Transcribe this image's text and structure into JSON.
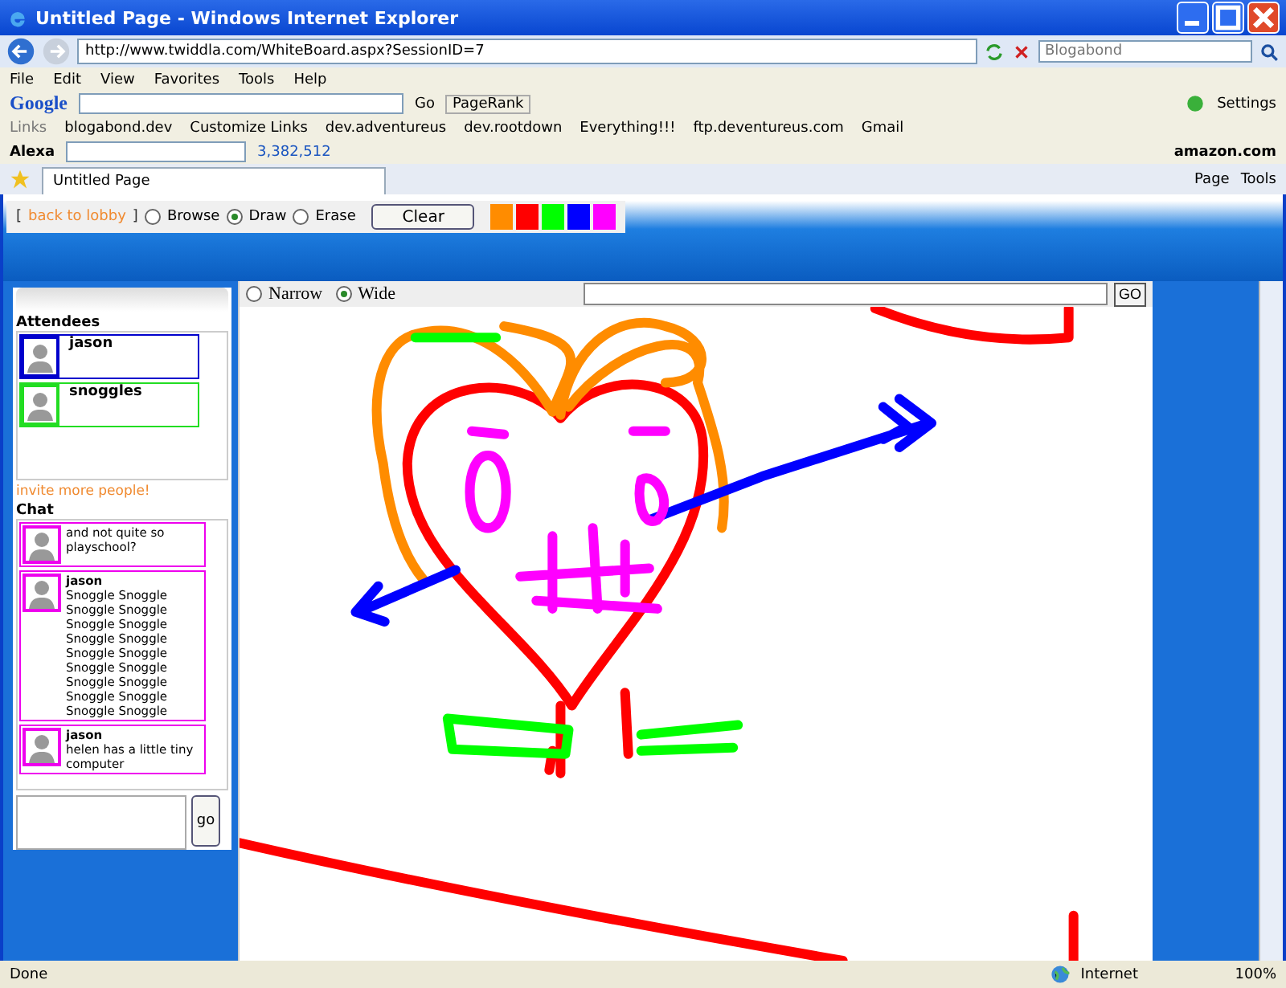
{
  "window": {
    "title": "Untitled Page - Windows Internet Explorer"
  },
  "address_bar": {
    "url": "http://www.twiddla.com/WhiteBoard.aspx?SessionID=7",
    "search_placeholder": "Blogabond"
  },
  "menu": [
    "File",
    "Edit",
    "View",
    "Favorites",
    "Tools",
    "Help"
  ],
  "google_toolbar": {
    "logo": "Google",
    "go": "Go",
    "pagerank": "PageRank",
    "settings": "Settings"
  },
  "links_bar": {
    "label": "Links",
    "items": [
      "blogabond.dev",
      "Customize Links",
      "dev.adventureus",
      "dev.rootdown",
      "Everything!!!",
      "ftp.deventureus.com",
      "Gmail"
    ]
  },
  "alexa_bar": {
    "logo": "Alexa",
    "rank": "3,382,512",
    "amazon": "amazon.com"
  },
  "tab": {
    "label": "Untitled Page"
  },
  "command_bar": {
    "page": "Page",
    "tools": "Tools"
  },
  "toolbar": {
    "open_bracket": "[",
    "back_link": "back to lobby",
    "close_bracket": "]",
    "modes": [
      {
        "label": "Browse",
        "selected": false
      },
      {
        "label": "Draw",
        "selected": true
      },
      {
        "label": "Erase",
        "selected": false
      }
    ],
    "clear": "Clear",
    "palette": [
      {
        "color": "#ff8c00"
      },
      {
        "color": "#ff0000"
      },
      {
        "color": "#00ff00"
      },
      {
        "color": "#0000ff"
      },
      {
        "color": "#ff00ff"
      }
    ]
  },
  "attendees": {
    "heading": "Attendees",
    "items": [
      {
        "name": "jason",
        "color": "#0000cc"
      },
      {
        "name": "snoggles",
        "color": "#22dd22"
      }
    ],
    "invite": "invite more people!"
  },
  "chat": {
    "heading": "Chat",
    "messages": [
      {
        "text": "and not quite so playschool?",
        "color": "#ee00ee"
      },
      {
        "name": "jason",
        "text": "Snoggle Snoggle Snoggle Snoggle Snoggle Snoggle Snoggle Snoggle Snoggle Snoggle Snoggle Snoggle Snoggle Snoggle Snoggle Snoggle Snoggle Snoggle",
        "color": "#ee00ee"
      },
      {
        "name": "jason",
        "text": "helen has a little tiny computer",
        "color": "#ee00ee"
      }
    ],
    "send": "go"
  },
  "canvas_toolbar": {
    "widths": [
      {
        "label": "Narrow",
        "selected": false
      },
      {
        "label": "Wide",
        "selected": true
      }
    ],
    "go": "GO"
  },
  "status_bar": {
    "status": "Done",
    "zone": "Internet",
    "zoom": "100%"
  }
}
